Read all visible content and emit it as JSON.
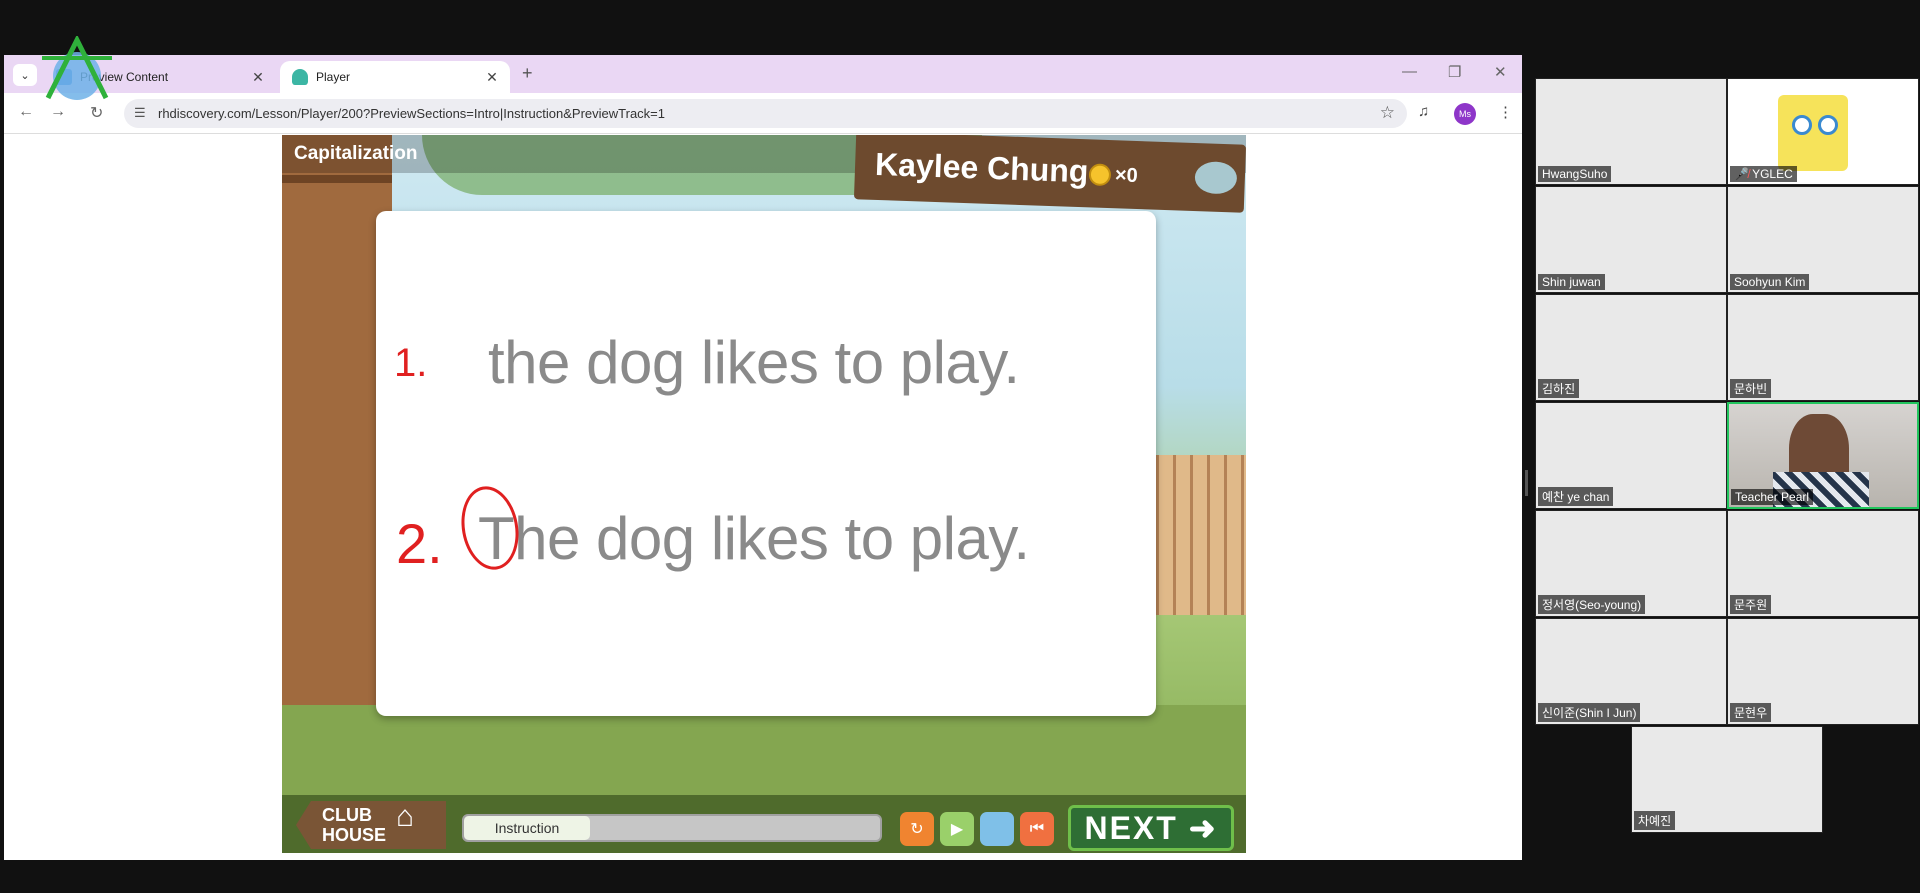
{
  "browser": {
    "tabs": [
      {
        "title": "Preview Content",
        "active": false
      },
      {
        "title": "Player",
        "active": true
      }
    ],
    "new_tab_symbol": "+",
    "url": "rhdiscovery.com/Lesson/Player/200?PreviewSections=Intro|Instruction&PreviewTrack=1",
    "profile_initials": "Ms"
  },
  "game": {
    "lesson_title": "Capitalization",
    "player_name": "Kaylee Chung",
    "coin_count": "×0",
    "sentences": [
      {
        "number": "1.",
        "text": "the dog likes to play."
      },
      {
        "number": "2.",
        "text": "The dog likes to play."
      }
    ],
    "clubhouse_label": "CLUB HOUSE",
    "progress_label": "Instruction",
    "next_label": "NEXT"
  },
  "zoom": {
    "participants": [
      {
        "name": "HwangSuho"
      },
      {
        "name": "YGLEC"
      },
      {
        "name": "Shin juwan"
      },
      {
        "name": "Soohyun Kim"
      },
      {
        "name": "김하진"
      },
      {
        "name": "문하빈"
      },
      {
        "name": "예찬 ye chan"
      },
      {
        "name": "Teacher Pearl"
      },
      {
        "name": "정서영(Seo-young)"
      },
      {
        "name": "문주원"
      },
      {
        "name": "신이준(Shin I Jun)"
      },
      {
        "name": "문현우"
      },
      {
        "name": "차예진"
      }
    ]
  },
  "colors": {
    "accent": "#21c55d",
    "tab_bar": "#ead7f4",
    "mark_red": "#e02020"
  }
}
